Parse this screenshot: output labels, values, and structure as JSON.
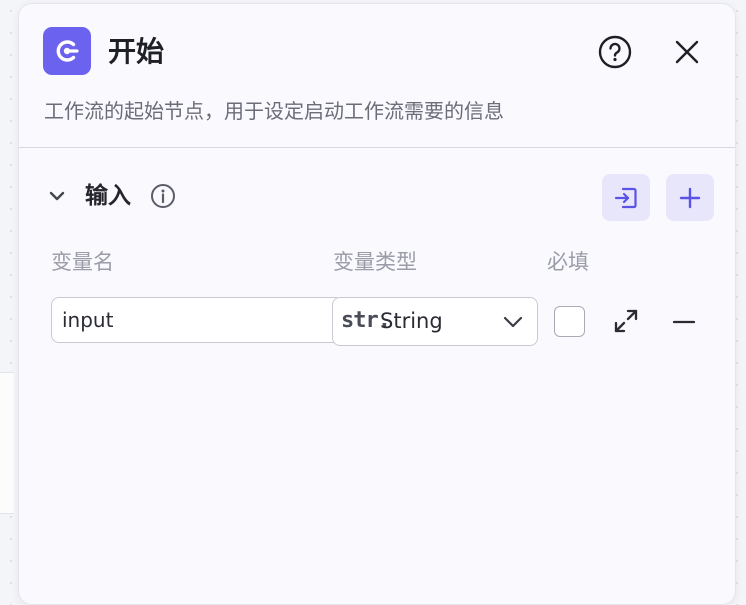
{
  "node": {
    "icon": "start-node-icon",
    "title": "开始",
    "description": "工作流的起始节点，用于设定启动工作流需要的信息",
    "accent_color": "#6b62f0"
  },
  "header_actions": {
    "help_icon": "help-circle-icon",
    "close_icon": "close-icon"
  },
  "input_section": {
    "title": "输入",
    "collapse_icon": "chevron-down-icon",
    "info_icon": "info-icon",
    "import_icon": "import-icon",
    "add_icon": "plus-icon",
    "columns": {
      "name": "变量名",
      "type": "变量类型",
      "required": "必填"
    },
    "rows": [
      {
        "name": "input",
        "type_badge": "str.",
        "type_label": "String",
        "required": false
      }
    ]
  }
}
